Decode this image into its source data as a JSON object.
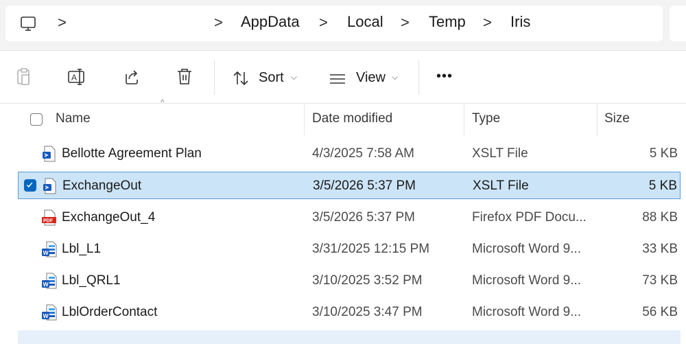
{
  "address": {
    "crumbs": [
      "AppData",
      "Local",
      "Temp",
      "Iris"
    ],
    "sep": ">"
  },
  "toolbar": {
    "sort_label": "Sort",
    "view_label": "View",
    "more_label": "•••"
  },
  "columns": {
    "name": "Name",
    "date": "Date modified",
    "type": "Type",
    "size": "Size"
  },
  "files": [
    {
      "name": "Bellotte Agreement Plan",
      "date": "4/3/2025 7:58 AM",
      "type": "XSLT File",
      "size": "5 KB",
      "icon": "xslt-file-icon",
      "selected": false
    },
    {
      "name": "ExchangeOut",
      "date": "3/5/2026 5:37 PM",
      "type": "XSLT File",
      "size": "5 KB",
      "icon": "xslt-file-icon",
      "selected": true
    },
    {
      "name": "ExchangeOut_4",
      "date": "3/5/2026 5:37 PM",
      "type": "Firefox PDF Docu...",
      "size": "88 KB",
      "icon": "pdf-file-icon",
      "selected": false
    },
    {
      "name": "Lbl_L1",
      "date": "3/31/2025 12:15 PM",
      "type": "Microsoft Word 9...",
      "size": "33 KB",
      "icon": "word-file-icon",
      "selected": false
    },
    {
      "name": "Lbl_QRL1",
      "date": "3/10/2025 3:52 PM",
      "type": "Microsoft Word 9...",
      "size": "73 KB",
      "icon": "word-file-icon",
      "selected": false
    },
    {
      "name": "LblOrderContact",
      "date": "3/10/2025 3:47 PM",
      "type": "Microsoft Word 9...",
      "size": "56 KB",
      "icon": "word-file-icon",
      "selected": false
    }
  ],
  "colors": {
    "selection_bg": "#cce4f7",
    "selection_border": "#5a9bd4",
    "accent": "#0067c0"
  }
}
